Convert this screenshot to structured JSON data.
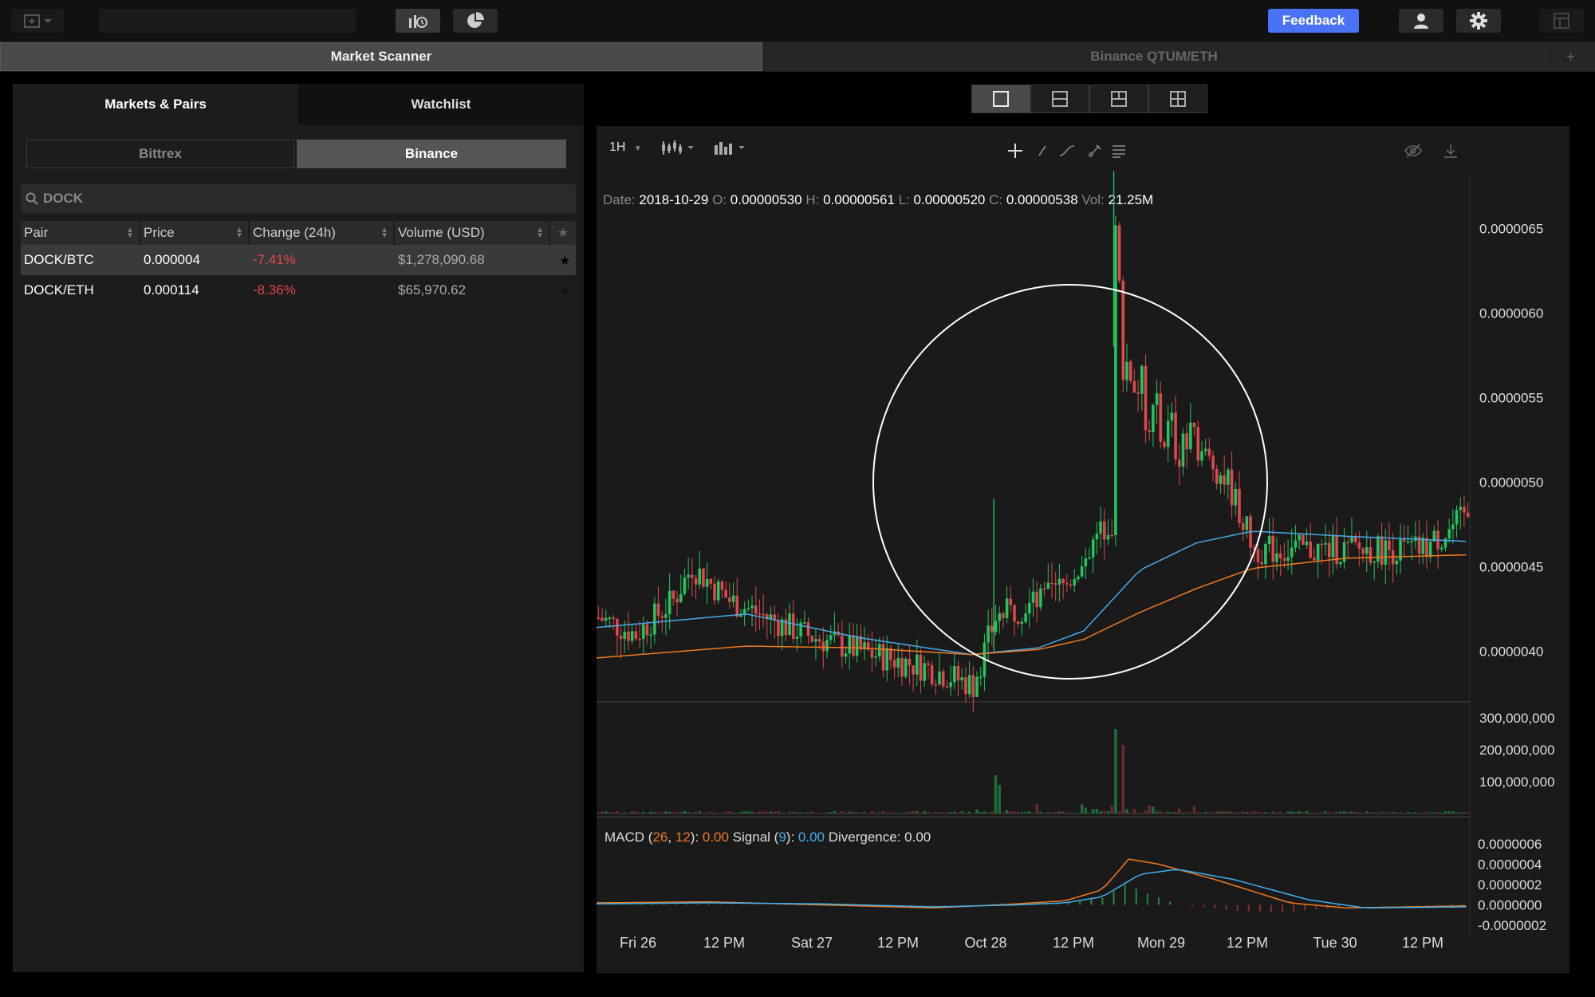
{
  "topbar": {
    "feedback_label": "Feedback",
    "icons": [
      "new-window-icon",
      "chevron-down-icon",
      "chart-clock-icon",
      "pie-chart-icon",
      "user-icon",
      "gear-icon",
      "layout-icon"
    ]
  },
  "tabs": [
    {
      "label": "Market Scanner",
      "active": true
    },
    {
      "label": "Binance QTUM/ETH",
      "active": false
    }
  ],
  "tab_add_label": "+",
  "left": {
    "subtabs": [
      "Markets & Pairs",
      "Watchlist"
    ],
    "exchanges": [
      "Bittrex",
      "Binance"
    ],
    "active_exchange": "Binance",
    "search_value": "DOCK",
    "columns": [
      "Pair",
      "Price",
      "Change (24h)",
      "Volume (USD)"
    ],
    "rows": [
      {
        "pair": "DOCK/BTC",
        "price": "0.000004",
        "change": "-7.41%",
        "volume": "$1,278,090.68",
        "starred": true
      },
      {
        "pair": "DOCK/ETH",
        "price": "0.000114",
        "change": "-8.36%",
        "volume": "$65,970.62",
        "starred": false
      }
    ]
  },
  "chart": {
    "interval": "1H",
    "ohlc": {
      "date_label": "Date:",
      "date": "2018-10-29",
      "o_label": "O:",
      "o": "0.00000530",
      "h_label": "H:",
      "h": "0.00000561",
      "l_label": "L:",
      "l": "0.00000520",
      "c_label": "C:",
      "c": "0.00000538",
      "vol_label": "Vol:",
      "vol": "21.25M"
    },
    "macd": {
      "prefix": "MACD (",
      "p1": "26",
      "sep": ", ",
      "p2": "12",
      "close1": "): ",
      "value": "0.00",
      "signal_label": " Signal (",
      "sp": "9",
      "close2": "): ",
      "signal_value": "0.00",
      "div_label": " Divergence: ",
      "div_value": "0.00"
    },
    "colors": {
      "up": "#22c55e",
      "down": "#e0474c",
      "ma_fast": "#4aa8e8",
      "ma_slow": "#f07a20",
      "macd": "#f07a20",
      "signal": "#3db0f0"
    }
  },
  "chart_data": {
    "type": "candlestick",
    "price_ticks": [
      "0.0000065",
      "0.0000060",
      "0.0000055",
      "0.0000050",
      "0.0000045",
      "0.0000040"
    ],
    "volume_ticks": [
      "300,000,000",
      "200,000,000",
      "100,000,000"
    ],
    "macd_ticks": [
      "0.0000006",
      "0.0000004",
      "0.0000002",
      "0.0000000",
      "-0.0000002"
    ],
    "x_ticks": [
      "Fri 26",
      "12 PM",
      "Sat 27",
      "12 PM",
      "Oct 28",
      "12 PM",
      "Mon 29",
      "12 PM",
      "Tue 30",
      "12 PM"
    ],
    "ylim": [
      3.7e-06,
      6.8e-06
    ],
    "close_path": [
      [
        0,
        4.2e-06
      ],
      [
        10,
        4.1e-06
      ],
      [
        20,
        4.3e-06
      ],
      [
        25,
        4.5e-06
      ],
      [
        35,
        4.3e-06
      ],
      [
        55,
        4.1e-06
      ],
      [
        70,
        4e-06
      ],
      [
        88,
        3.9e-06
      ],
      [
        100,
        3.8e-06
      ],
      [
        106,
        4.2e-06
      ],
      [
        118,
        4.3e-06
      ],
      [
        125,
        4.4e-06
      ],
      [
        137,
        4.8e-06
      ],
      [
        138,
        6.4e-06
      ],
      [
        140,
        5.8e-06
      ],
      [
        145,
        5.5e-06
      ],
      [
        150,
        5.3e-06
      ],
      [
        160,
        5.2e-06
      ],
      [
        168,
        5e-06
      ],
      [
        175,
        4.6e-06
      ],
      [
        190,
        4.6e-06
      ],
      [
        205,
        4.6e-06
      ],
      [
        220,
        4.6e-06
      ],
      [
        232,
        4.8e-06
      ]
    ],
    "ma_fast": [
      [
        0,
        4.14e-06
      ],
      [
        40,
        4.22e-06
      ],
      [
        70,
        4.08e-06
      ],
      [
        100,
        3.98e-06
      ],
      [
        118,
        4.02e-06
      ],
      [
        130,
        4.12e-06
      ],
      [
        145,
        4.48e-06
      ],
      [
        160,
        4.64e-06
      ],
      [
        175,
        4.71e-06
      ],
      [
        200,
        4.68e-06
      ],
      [
        232,
        4.65e-06
      ]
    ],
    "ma_slow": [
      [
        0,
        3.96e-06
      ],
      [
        40,
        4.03e-06
      ],
      [
        70,
        4.02e-06
      ],
      [
        100,
        3.98e-06
      ],
      [
        118,
        4.01e-06
      ],
      [
        130,
        4.07e-06
      ],
      [
        145,
        4.23e-06
      ],
      [
        160,
        4.37e-06
      ],
      [
        175,
        4.49e-06
      ],
      [
        200,
        4.55e-06
      ],
      [
        232,
        4.57e-06
      ]
    ],
    "volume_spikes": [
      [
        106,
        120000000
      ],
      [
        107,
        90000000
      ],
      [
        137,
        265000000
      ],
      [
        138,
        265000000
      ],
      [
        140,
        215000000
      ]
    ]
  }
}
